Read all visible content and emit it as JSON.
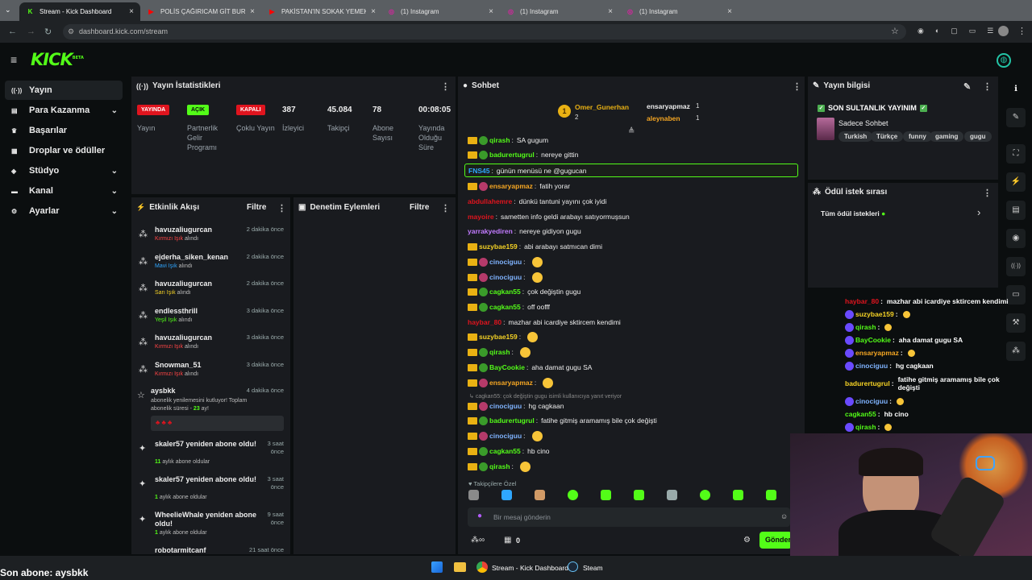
{
  "browser": {
    "tabs": [
      {
        "label": "Stream - Kick Dashboard",
        "fav": "K",
        "fav_color": "#53fc18",
        "active": true
      },
      {
        "label": "POLİS ÇAĞIRICAM GİT BURDAN",
        "fav": "▶",
        "fav_color": "#ff0000"
      },
      {
        "label": "PAKİSTAN'IN SOKAK YEMEKLERİ",
        "fav": "▶",
        "fav_color": "#ff0000"
      },
      {
        "label": "(1) Instagram",
        "fav": "◎",
        "fav_color": "#d6249f"
      },
      {
        "label": "(1) Instagram",
        "fav": "◎",
        "fav_color": "#d6249f"
      },
      {
        "label": "(1) Instagram",
        "fav": "◎",
        "fav_color": "#d6249f"
      }
    ],
    "url": "dashboard.kick.com/stream"
  },
  "app": {
    "logo": "KICK",
    "logo_sup": "BETA"
  },
  "sidebar": {
    "items": [
      {
        "label": "Yayın",
        "icon": "broadcast-icon",
        "active": true
      },
      {
        "label": "Para Kazanma",
        "icon": "money-icon",
        "chevron": true
      },
      {
        "label": "Başarılar",
        "icon": "trophy-icon"
      },
      {
        "label": "Droplar ve ödüller",
        "icon": "gift-icon"
      },
      {
        "label": "Stüdyo",
        "icon": "studio-icon",
        "chevron": true
      },
      {
        "label": "Kanal",
        "icon": "channel-icon",
        "chevron": true
      },
      {
        "label": "Ayarlar",
        "icon": "gear-icon",
        "chevron": true
      }
    ]
  },
  "stats": {
    "title": "Yayın İstatistikleri",
    "items": [
      {
        "badge": "YAYINDA",
        "badge_color": "#e0141e",
        "label": "Yayın"
      },
      {
        "badge": "AÇIK",
        "badge_color": "#53fc18",
        "label": "Partnerlik Gelir Programı"
      },
      {
        "badge": "KAPALI",
        "badge_color": "#e0141e",
        "label": "Çoklu Yayın"
      },
      {
        "value": "387",
        "label": "İzleyici"
      },
      {
        "value": "45.084",
        "label": "Takipçi"
      },
      {
        "value": "78",
        "label": "Abone Sayısı"
      },
      {
        "value": "00:08:05",
        "label": "Yayında Olduğu Süre"
      }
    ]
  },
  "activity": {
    "title": "Etkinlik Akışı",
    "filter": "Filtre",
    "items": [
      {
        "name": "havuzaliugurcan",
        "color_word": "Kırmızı Işık",
        "rest": " alındı",
        "word_color": "#ff4545",
        "time": "2 dakika önce"
      },
      {
        "name": "ejderha_siken_kenan",
        "color_word": "Mavi Işık",
        "rest": " alındı",
        "word_color": "#2fa7ff",
        "time": "2 dakika önce"
      },
      {
        "name": "havuzaliugurcan",
        "color_word": "Sarı Işık",
        "rest": " alındı",
        "word_color": "#f5d225",
        "time": "2 dakika önce"
      },
      {
        "name": "endlessthrill",
        "color_word": "Yeşil Işık",
        "rest": " alındı",
        "word_color": "#53fc18",
        "time": "3 dakika önce"
      },
      {
        "name": "havuzaliugurcan",
        "color_word": "Kırmızı Işık",
        "rest": " alındı",
        "word_color": "#ff4545",
        "time": "3 dakika önce"
      },
      {
        "name": "Snowman_51",
        "color_word": "Kırmızı Işık",
        "rest": " alındı",
        "word_color": "#ff4545",
        "time": "3 dakika önce"
      }
    ],
    "sub": {
      "name": "aysbkk",
      "time": "4 dakika önce",
      "text1": "abonelik yenilemesini kutluyor! Toplam",
      "text2": "abonelik süresi - ",
      "months": "23",
      "text3": " ay!"
    },
    "subs": [
      {
        "name": "skaler57 yeniden abone oldu!",
        "count": "11",
        "suffix": " aylık abone oldular",
        "time": "3 saat önce"
      },
      {
        "name": "skaler57 yeniden abone oldu!",
        "count": "1",
        "suffix": " aylık abone oldular",
        "time": "3 saat önce"
      },
      {
        "name": "WheelieWhale yeniden abone oldu!",
        "count": "1",
        "suffix": " aylık abone oldular",
        "time": "9 saat önce"
      }
    ],
    "cut_name": "robotarmitcanf",
    "cut_time": "21 saat önce"
  },
  "moderation": {
    "title": "Denetim Eylemleri",
    "filter": "Filtre"
  },
  "chat": {
    "title": "Sohbet",
    "top": [
      {
        "name": "Omer_Gunerhan",
        "count": "2"
      },
      {
        "name": "ensaryapmaz",
        "count": "1"
      },
      {
        "name": "aleynaben",
        "count": "1"
      }
    ],
    "lines": [
      {
        "u": "qirash",
        "c": "#53fc18",
        "m": "SA gugum"
      },
      {
        "u": "badurertugrul",
        "c": "#53fc18",
        "m": "nereye gittin"
      },
      {
        "u": "FNS45",
        "c": "#2fa7ff",
        "m": "günün menüsü ne @gugucan",
        "highlight": true
      },
      {
        "u": "ensaryapmaz",
        "c": "#f5a623",
        "m": "fatih yorar"
      },
      {
        "u": "abdullahemre",
        "c": "#e0141e",
        "m": "dünkü tantuni yayını çok iyidi"
      },
      {
        "u": "mayoire",
        "c": "#e0141e",
        "m": "sametten info geldi arabayı satıyormuşsun"
      },
      {
        "u": "yarrakyediren",
        "c": "#c27bff",
        "m": "nereye gidiyon gugu"
      },
      {
        "u": "suzybae159",
        "c": "#f5d225",
        "m": "abi arabayı satmıcan dimi"
      },
      {
        "u": "cinociguu",
        "c": "#7fb3ff",
        "m": ""
      },
      {
        "u": "cinociguu",
        "c": "#7fb3ff",
        "m": ""
      },
      {
        "u": "cagkan55",
        "c": "#53fc18",
        "m": "çok değiştin gugu"
      },
      {
        "u": "cagkan55",
        "c": "#53fc18",
        "m": "off oofff"
      },
      {
        "u": "haybar_80",
        "c": "#e0141e",
        "m": "mazhar abi icardiye sktircem kendimi"
      },
      {
        "u": "suzybae159",
        "c": "#f5d225",
        "m": ""
      },
      {
        "u": "qirash",
        "c": "#53fc18",
        "m": ""
      },
      {
        "u": "BayCookie",
        "c": "#53fc18",
        "m": "aha damat gugu SA"
      },
      {
        "u": "ensaryapmaz",
        "c": "#f5a623",
        "m": ""
      },
      {
        "u": "cinociguu",
        "c": "#7fb3ff",
        "m": "hg cagkaan"
      },
      {
        "u": "badurertugrul",
        "c": "#53fc18",
        "m": "fatihe gitmiş aramamış bile çok değişti"
      },
      {
        "u": "cinociguu",
        "c": "#7fb3ff",
        "m": ""
      },
      {
        "u": "cagkan55",
        "c": "#53fc18",
        "m": "hb cino"
      },
      {
        "u": "qirash",
        "c": "#53fc18",
        "m": ""
      }
    ],
    "reply": "cagkan55: çok değiştin gugu isimli kullanıcıya yanıt veriyor",
    "followers_only": "Takipçilere Özel",
    "placeholder": "Bir mesaj gönderin",
    "count": "0",
    "send": "Gönder"
  },
  "info": {
    "title": "Yayın bilgisi",
    "stream_title": "SON SULTANLIK YAYINIM",
    "category": "Sadece Sohbet",
    "tags": [
      "Turkish",
      "Türkçe",
      "funny",
      "gaming",
      "gugu"
    ]
  },
  "rewards": {
    "title": "Ödül istek sırası",
    "all": "Tüm ödül istekleri"
  },
  "overlay": [
    {
      "u": "haybar_80",
      "c": "#e0141e",
      "m": "mazhar abi icardiye sktircem kendimi"
    },
    {
      "u": "suzybae159",
      "c": "#f5d225",
      "m": ""
    },
    {
      "u": "qirash",
      "c": "#53fc18",
      "m": ""
    },
    {
      "u": "BayCookie",
      "c": "#53fc18",
      "m": "aha damat gugu SA"
    },
    {
      "u": "ensaryapmaz",
      "c": "#f5a623",
      "m": ""
    },
    {
      "u": "cinociguu",
      "c": "#7fb3ff",
      "m": "hg cagkaan"
    },
    {
      "u": "badurertugrul",
      "c": "#f5d225",
      "m": "fatihe gitmiş aramamış bile çok değişti"
    },
    {
      "u": "cinociguu",
      "c": "#7fb3ff",
      "m": ""
    },
    {
      "u": "cagkan55",
      "c": "#53fc18",
      "m": "hb cino"
    },
    {
      "u": "qirash",
      "c": "#53fc18",
      "m": ""
    }
  ],
  "last_sub": "Son abone: aysbkk",
  "taskbar": {
    "kick": "Stream - Kick Dashboard",
    "steam": "Steam"
  }
}
